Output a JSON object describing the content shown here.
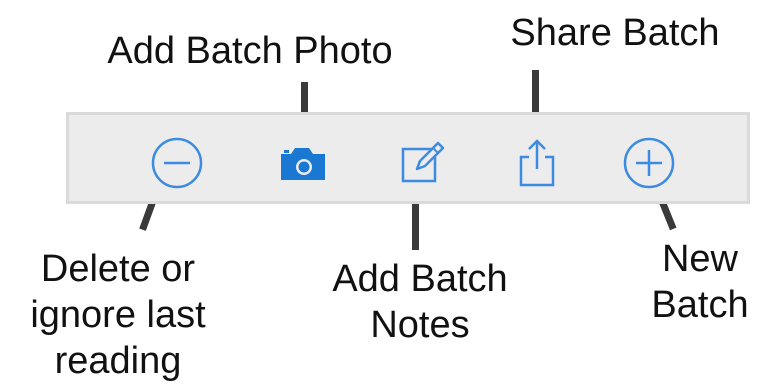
{
  "callouts": {
    "add_batch_photo": "Add Batch Photo",
    "share_batch": "Share Batch",
    "delete_last_reading": "Delete or\nignore last\nreading",
    "add_batch_notes": "Add Batch\nNotes",
    "new_batch": "New\nBatch"
  },
  "toolbar": {
    "icons": [
      "minus-circle-icon",
      "camera-icon",
      "compose-icon",
      "share-icon",
      "plus-circle-icon"
    ],
    "accent_color": "#1a78d2",
    "background_color": "#ececec"
  }
}
